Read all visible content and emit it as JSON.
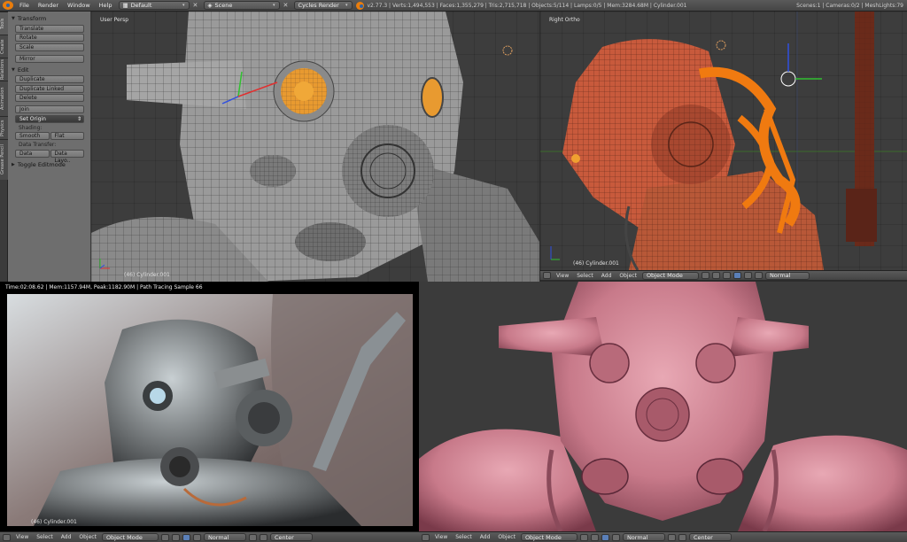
{
  "topbar": {
    "menus": [
      "File",
      "Render",
      "Window",
      "Help"
    ],
    "layout": "Default",
    "scene": "Scene",
    "engine": "Cycles Render",
    "stats": "v2.77.3 | Verts:1,494,553 | Faces:1,355,279 | Tris:2,715,718 | Objects:5/114 | Lamps:0/5 | Mem:3284.68M | Cylinder.001",
    "stats_right": "Scenes:1 | Cameras:0/2 | MeshLights:79"
  },
  "tabs": [
    "Tools",
    "Create",
    "Relations",
    "Animation",
    "Physics",
    "Grease Pencil"
  ],
  "toolshelf": {
    "transform_title": "Transform",
    "transform_buttons": [
      "Translate",
      "Rotate",
      "Scale",
      "Mirror"
    ],
    "edit_title": "Edit",
    "edit_buttons": [
      "Duplicate",
      "Duplicate Linked",
      "Delete"
    ],
    "join": "Join",
    "set_origin": "Set Origin",
    "shading_label": "Shading:",
    "smooth": "Smooth",
    "flat": "Flat",
    "data_transfer_label": "Data Transfer:",
    "data": "Data",
    "data_layout": "Data Layo..",
    "toggle_editmode": "Toggle Editmode"
  },
  "viewports": {
    "top_left": {
      "label": "User Persp",
      "object": "(46) Cylinder.001"
    },
    "top_right": {
      "label": "Right Ortho",
      "object": "(46) Cylinder.001"
    },
    "bottom_left": {
      "status": "Time:02:08.62 | Mem:1157.94M, Peak:1182.90M | Path Tracing Sample 66",
      "object": "(46) Cylinder.001"
    }
  },
  "headers": {
    "menus": [
      "View",
      "Select",
      "Add",
      "Object"
    ],
    "mode": "Object Mode",
    "shading": "Normal",
    "pivot": "Center"
  },
  "colors": {
    "accent": "#e87d0d",
    "wire_orange": "#c85a3c",
    "clay_pink": "#c87a8a",
    "selection_orange": "#f07a10"
  }
}
